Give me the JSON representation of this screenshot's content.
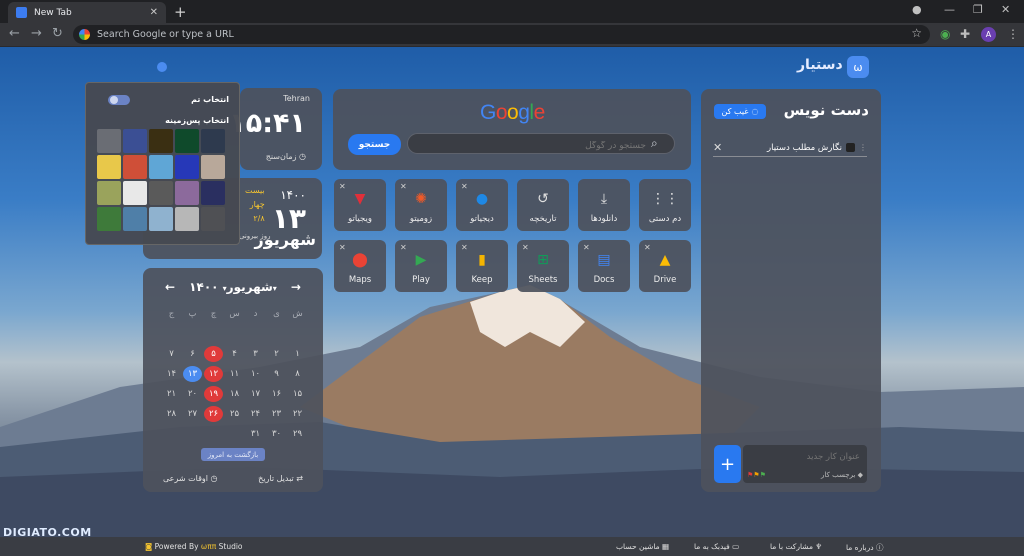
{
  "browser": {
    "tab_title": "New Tab",
    "omnibox_placeholder": "Search Google or type a URL",
    "avatar_letter": "A"
  },
  "brand": {
    "name": "دستیار"
  },
  "theme_popup": {
    "title": "انتخاب تم",
    "background_title": "انتخاب پس‌زمینه",
    "swatches": [
      "#6a6d74",
      "#3b4f94",
      "#3a2f12",
      "#0f4a2b",
      "#2e3a4e",
      "#e8c84a",
      "#cf4f38",
      "#5fa6d6",
      "#2638b8",
      "#b8a89a",
      "#9aa35c",
      "#e8e8e8",
      "#5a5a5a",
      "#8c6a9c",
      "#2a2f60",
      "#3e7a3a",
      "#4f7fa8",
      "#8fb2cf",
      "#b7b7b7",
      "#4f5054"
    ]
  },
  "clock": {
    "city": "Tehran",
    "time": "۱۵:۴۱",
    "timer_label": "زمان‌سنج"
  },
  "date": {
    "year": "۱۴۰۰",
    "day": "۱۳",
    "month": "شهریور",
    "side_lines": [
      "بیست",
      "چهار",
      "۲/۸"
    ],
    "bottom_lines": [
      "روز بیرونی"
    ]
  },
  "calendar": {
    "month_label": "شهریور",
    "year_label": "۱۴۰۰",
    "headers": [
      "ش",
      "ی",
      "د",
      "س",
      "چ",
      "پ",
      "ج"
    ],
    "days": [
      "",
      "",
      "",
      "",
      "",
      "",
      "",
      "۱",
      "۲",
      "۳",
      "۴",
      "۵",
      "۶",
      "۷",
      "۸",
      "۹",
      "۱۰",
      "۱۱",
      "۱۲",
      "۱۳",
      "۱۴",
      "۱۵",
      "۱۶",
      "۱۷",
      "۱۸",
      "۱۹",
      "۲۰",
      "۲۱",
      "۲۲",
      "۲۳",
      "۲۴",
      "۲۵",
      "۲۶",
      "۲۷",
      "۲۸",
      "۲۹",
      "۳۰",
      "۳۱"
    ],
    "red_days": [
      "۵",
      "۱۲",
      "۱۹",
      "۲۶"
    ],
    "today": "۱۳",
    "today_button": "بازگشت به امروز",
    "change_date": "تبدیل تاریخ",
    "prayer_times": "اوقات شرعی"
  },
  "search": {
    "placeholder": "جستجو در گوگل",
    "button": "جستجو"
  },
  "shortcuts": [
    {
      "label": "دم دستی",
      "icon": "grid-icon",
      "color": "#e0e0e0"
    },
    {
      "label": "دانلودها",
      "icon": "download-icon",
      "color": "#e0e0e0"
    },
    {
      "label": "تاریخچه",
      "icon": "history-icon",
      "color": "#e0e0e0"
    },
    {
      "label": "دیجیاتو",
      "icon": "digiato-icon",
      "color": "#1e88e5"
    },
    {
      "label": "زومیتو",
      "icon": "zoomit-icon",
      "color": "#f05a28"
    },
    {
      "label": "ویجیاتو",
      "icon": "vigiato-icon",
      "color": "#e0303a"
    },
    {
      "label": "Drive",
      "icon": "drive-icon",
      "color": "#fbbc05"
    },
    {
      "label": "Docs",
      "icon": "docs-icon",
      "color": "#4285f4"
    },
    {
      "label": "Sheets",
      "icon": "sheets-icon",
      "color": "#0f9d58"
    },
    {
      "label": "Keep",
      "icon": "keep-icon",
      "color": "#f4b400"
    },
    {
      "label": "Play",
      "icon": "play-icon",
      "color": "#34a853"
    },
    {
      "label": "Maps",
      "icon": "maps-icon",
      "color": "#ea4335"
    }
  ],
  "notes": {
    "title": "دست نویس",
    "hide_label": "غیب کن",
    "tasks": [
      {
        "label": "نگارش مطلب دستیار"
      }
    ],
    "new_task_placeholder": "عنوان کار جدید",
    "tag_label": "برچسب کار"
  },
  "footer": {
    "powered": "Powered By",
    "studio_brand": "ωππ",
    "studio": "Studio",
    "calc": "ماشین حساب",
    "feedback": "فیدبک به ما",
    "contribute": "مشارکت با ما",
    "about": "درباره ما"
  },
  "watermark": "DIGIATO.COM"
}
